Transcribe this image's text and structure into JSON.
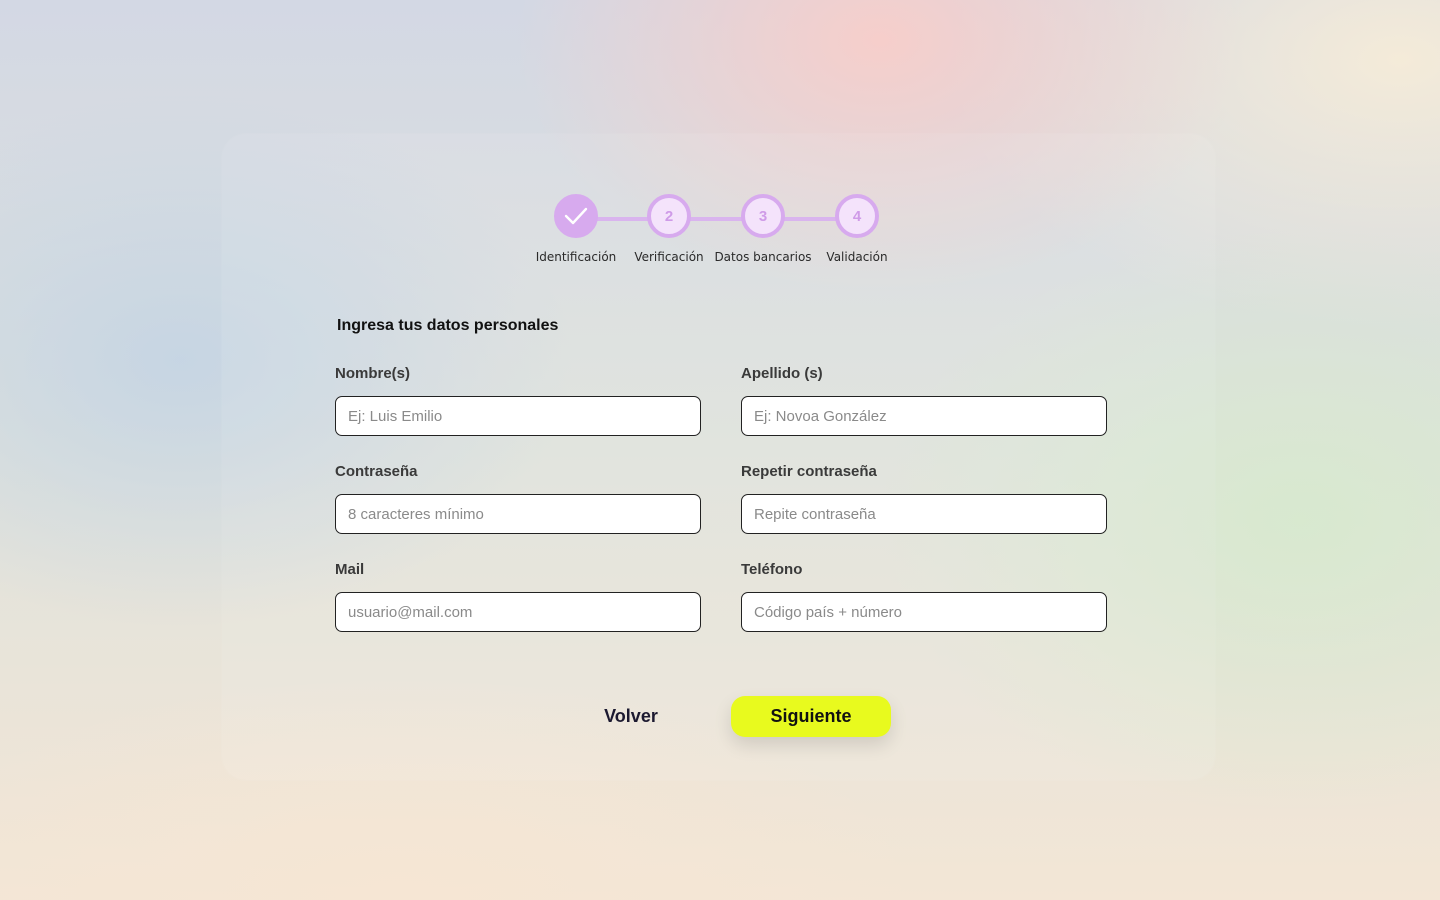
{
  "stepper": {
    "steps": [
      {
        "label": "Identificación",
        "number": "",
        "status": "done",
        "icon": "check-icon"
      },
      {
        "label": "Verificación",
        "number": "2",
        "status": "pending"
      },
      {
        "label": "Datos bancarios",
        "number": "3",
        "status": "pending"
      },
      {
        "label": "Validación",
        "number": "4",
        "status": "pending"
      }
    ],
    "accent_color": "#d7aaee"
  },
  "form": {
    "title": "Ingresa tus datos personales",
    "fields": {
      "nombre": {
        "label": "Nombre(s)",
        "value": "",
        "placeholder": "Ej: Luis Emilio"
      },
      "apellido": {
        "label": "Apellido (s)",
        "value": "",
        "placeholder": "Ej: Novoa González"
      },
      "contrasena": {
        "label": "Contraseña",
        "value": "",
        "placeholder": "8 caracteres mínimo"
      },
      "repetir": {
        "label": "Repetir contraseña",
        "value": "",
        "placeholder": "Repite contraseña"
      },
      "mail": {
        "label": "Mail",
        "value": "",
        "placeholder": "usuario@mail.com"
      },
      "telefono": {
        "label": "Teléfono",
        "value": "",
        "placeholder": "Código país + número"
      }
    }
  },
  "actions": {
    "back_label": "Volver",
    "next_label": "Siguiente",
    "next_color": "#e8fa1e"
  }
}
